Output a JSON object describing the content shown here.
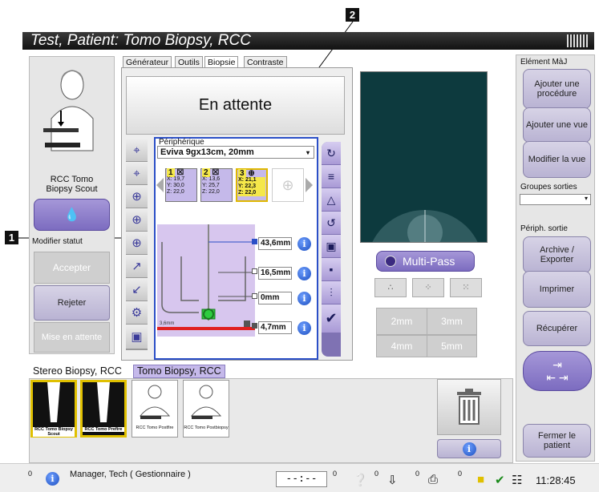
{
  "window": {
    "title": "Test, Patient:  Tomo Biopsy, RCC"
  },
  "callouts": [
    "1",
    "2"
  ],
  "tabs": [
    {
      "label": "Générateur"
    },
    {
      "label": "Outils"
    },
    {
      "label": "Biopsie"
    },
    {
      "label": "Contraste"
    }
  ],
  "left_panel": {
    "view_label": "RCC Tomo\nBiopsy Scout",
    "modify_status": "Modifier statut",
    "accept": "Accepter",
    "reject": "Rejeter",
    "pending": "Mise en attente"
  },
  "biopsy": {
    "status": "En attente",
    "device_label": "Périphérique",
    "device_value": "Eviva 9gx13cm, 20mm",
    "targets": [
      {
        "num": "1",
        "x": "X: 19,7",
        "y": "Y: 30,0",
        "z": "Z: 22,0"
      },
      {
        "num": "2",
        "x": "X: 13,6",
        "y": "Y: 25,7",
        "z": "Z: 22,0"
      },
      {
        "num": "3",
        "x": "X: 21,1",
        "y": "Y: 22,3",
        "z": "Z: 22,0"
      }
    ],
    "depths": [
      "43,6mm",
      "16,5mm",
      "0mm",
      "4,7mm"
    ],
    "scale_label": "3,6mm"
  },
  "image_panel": {
    "multipass": "Multi-Pass",
    "spacing": [
      "2mm",
      "3mm",
      "4mm",
      "5mm"
    ]
  },
  "right_panel": {
    "header": "Elément MàJ",
    "add_procedure": "Ajouter une procédure",
    "add_view": "Ajouter une vue",
    "edit_view": "Modifier la vue",
    "output_groups": "Groupes sorties",
    "output_devices": "Périph. sortie",
    "archive": "Archive / Exporter",
    "print": "Imprimer",
    "retrieve": "Récupérer",
    "close_patient": "Fermer le patient"
  },
  "procedure_tabs": [
    "Stereo Biopsy, RCC",
    "Tomo Biopsy, RCC"
  ],
  "thumbnails": [
    {
      "label": "RCC Tomo Biopsy Scout"
    },
    {
      "label": "RCC Tomo Prefire"
    },
    {
      "label": "RCC Tomo Postfire"
    },
    {
      "label": "RCC Tomo Postbiopsy"
    }
  ],
  "status_bar": {
    "counter_left": "0",
    "user": "Manager, Tech ( Gestionnaire )",
    "time_field": "--:--",
    "counts": [
      "0",
      "0",
      "0",
      "0",
      "0"
    ],
    "clock": "11:28:45"
  },
  "colors": {
    "accent_purple": "#7c6cc0",
    "title_bg": "#1a1a1a",
    "target_yellow": "#f5e84a",
    "blue_outline": "#2b4fc7"
  }
}
